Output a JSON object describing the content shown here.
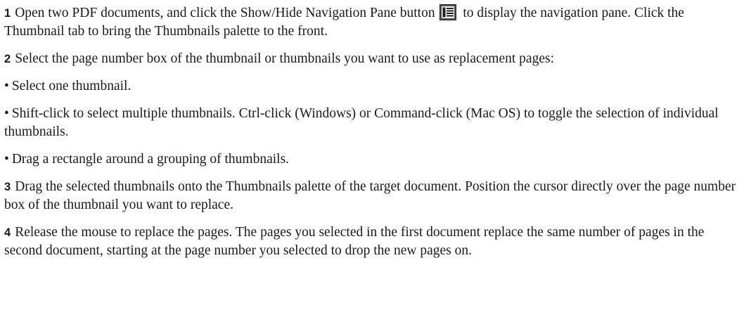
{
  "steps": {
    "s1": {
      "num": "1",
      "text_before_icon": "Open two PDF documents, and click the Show/Hide Navigation Pane button",
      "icon_name": "show-hide-navigation-pane-icon",
      "text_after_icon": "to display the navigation pane. Click the Thumbnail tab to bring the Thumbnails palette to the front."
    },
    "s2": {
      "num": "2",
      "text": "Select the page number box of the thumbnail or thumbnails you want to use as replacement pages:"
    },
    "bullets": [
      {
        "mark": "•",
        "text": "Select one thumbnail."
      },
      {
        "mark": "•",
        "text": "Shift-click to select multiple thumbnails. Ctrl-click (Windows) or Command-click (Mac OS) to toggle the selection of individual thumbnails."
      },
      {
        "mark": "•",
        "text": "Drag a rectangle around a grouping of thumbnails."
      }
    ],
    "s3": {
      "num": "3",
      "text": "Drag the selected thumbnails onto the Thumbnails palette of the target document. Position the cursor directly over the page number box of the thumbnail you want to replace."
    },
    "s4": {
      "num": "4",
      "text": "Release the mouse to replace the pages. The pages you selected in the first document replace the same number of pages in the second document, starting at the page number you selected to drop the new pages on."
    }
  }
}
